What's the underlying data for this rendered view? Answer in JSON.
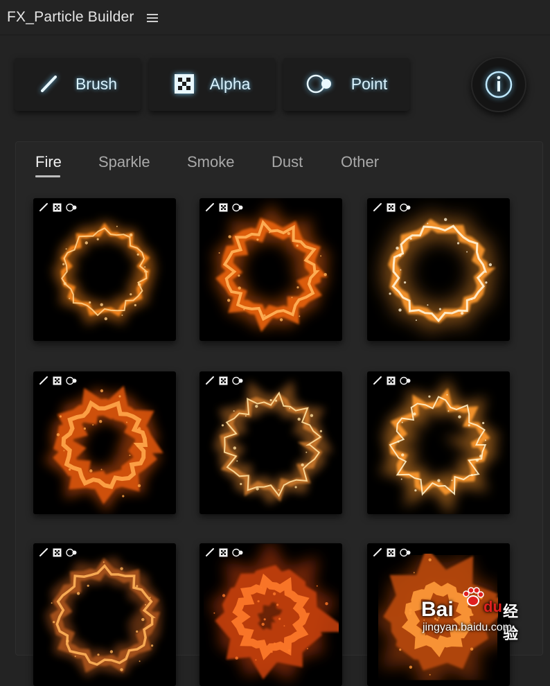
{
  "app": {
    "title": "FX_Particle Builder",
    "menu_icon": "hamburger-menu-icon"
  },
  "toolbar": {
    "buttons": [
      {
        "label": "Brush",
        "icon": "brush-icon"
      },
      {
        "label": "Alpha",
        "icon": "alpha-checker-icon"
      },
      {
        "label": "Point",
        "icon": "point-toggle-icon"
      }
    ],
    "info_icon": "info-icon",
    "glow_color": "#78d2ff"
  },
  "tabs": [
    {
      "label": "Fire",
      "active": true
    },
    {
      "label": "Sparkle",
      "active": false
    },
    {
      "label": "Smoke",
      "active": false
    },
    {
      "label": "Dust",
      "active": false
    },
    {
      "label": "Other",
      "active": false
    }
  ],
  "presets": [
    {
      "style": "thin-ring"
    },
    {
      "style": "flame-ring"
    },
    {
      "style": "bright-ring"
    },
    {
      "style": "chunky-ring"
    },
    {
      "style": "sparkle-ring"
    },
    {
      "style": "wispy-ring"
    },
    {
      "style": "dust-ring"
    },
    {
      "style": "dense-ring"
    },
    {
      "style": "smoke-blob"
    }
  ],
  "watermark": {
    "brand": "Bai",
    "brand_suffix": "du",
    "brand_cn": "经验",
    "url": "jingyan.baidu.com"
  }
}
